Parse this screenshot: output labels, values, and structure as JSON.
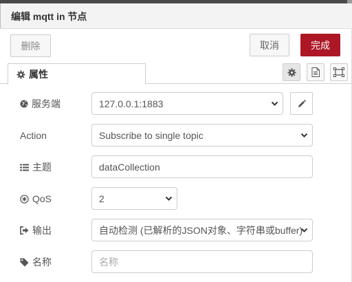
{
  "header": {
    "title": "编辑 mqtt in 节点"
  },
  "toolbar": {
    "delete_label": "删除",
    "cancel_label": "取消",
    "done_label": "完成"
  },
  "tabs": [
    {
      "label": "属性"
    }
  ],
  "form": {
    "server": {
      "label": "服务端",
      "value": "127.0.0.1:1883"
    },
    "action": {
      "label": "Action",
      "value": "Subscribe to single topic"
    },
    "topic": {
      "label": "主题",
      "value": "dataCollection"
    },
    "qos": {
      "label": "QoS",
      "value": "2"
    },
    "output": {
      "label": "输出",
      "value": "自动检测 (已解析的JSON对象、字符串或buffer)"
    },
    "name": {
      "label": "名称",
      "placeholder": "名称"
    }
  },
  "colors": {
    "accent": "#ad1625",
    "header_bg": "#f3f3f3",
    "border": "#cccccc"
  },
  "icons": {
    "server": "globe-icon",
    "topic": "list-icon",
    "qos": "asterisk-circle-icon",
    "output": "sign-out-icon",
    "name": "tag-icon",
    "tab": "gear-icon",
    "edit": "pencil-icon",
    "caret": "chevron-down-icon"
  }
}
